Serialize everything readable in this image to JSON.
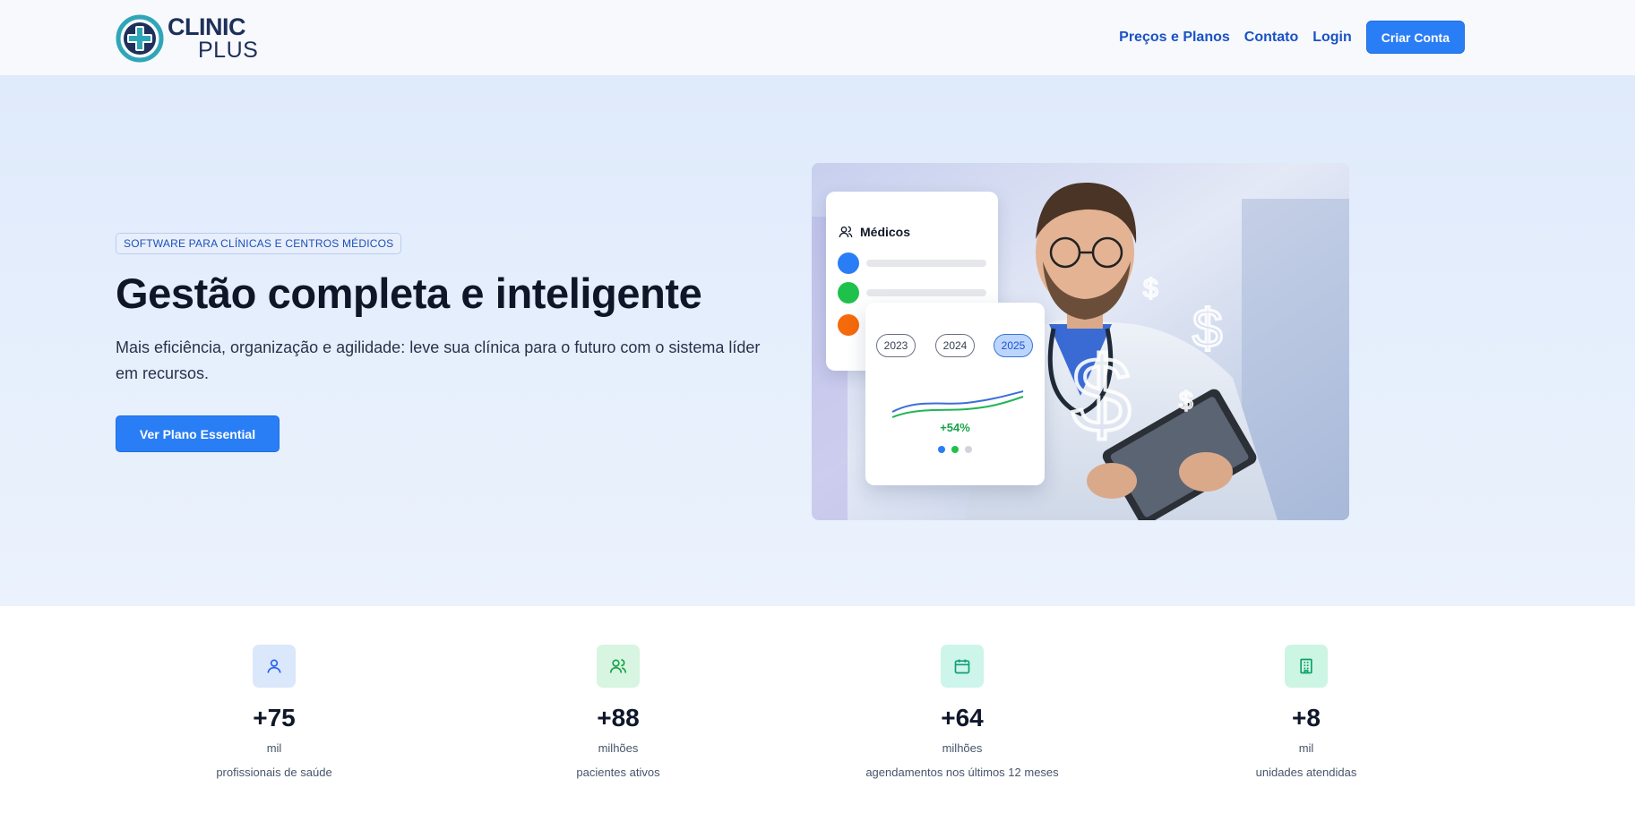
{
  "header": {
    "logo": {
      "line1": "CLINIC",
      "line2": "PLUS"
    },
    "nav": {
      "pricing": "Preços e Planos",
      "contact": "Contato",
      "login": "Login",
      "signup": "Criar Conta"
    }
  },
  "hero": {
    "badge": "SOFTWARE PARA CLÍNICAS E CENTROS MÉDICOS",
    "headline": "Gestão completa e inteligente",
    "subline": "Mais eficiência, organização e agilidade: leve sua clínica para o futuro com o sistema líder em recursos.",
    "button": "Ver Plano Essential",
    "card_medicos": {
      "title": "Médicos"
    },
    "card_chart": {
      "years": [
        "2023",
        "2024",
        "2025"
      ],
      "active_year": "2025",
      "growth": "+54%"
    }
  },
  "stats": [
    {
      "icon": "user-icon",
      "value": "+75",
      "unit": "mil",
      "label": "profissionais de saúde"
    },
    {
      "icon": "users-icon",
      "value": "+88",
      "unit": "milhões",
      "label": "pacientes ativos"
    },
    {
      "icon": "calendar-icon",
      "value": "+64",
      "unit": "milhões",
      "label": "agendamentos nos últimos 12 meses"
    },
    {
      "icon": "building-icon",
      "value": "+8",
      "unit": "mil",
      "label": "unidades atendidas"
    }
  ],
  "colors": {
    "primary": "#2a7ef5",
    "nav_link": "#1a52c6",
    "hero_bg": "#e3ecfb",
    "heading": "#0e1628",
    "green": "#18a34a"
  }
}
